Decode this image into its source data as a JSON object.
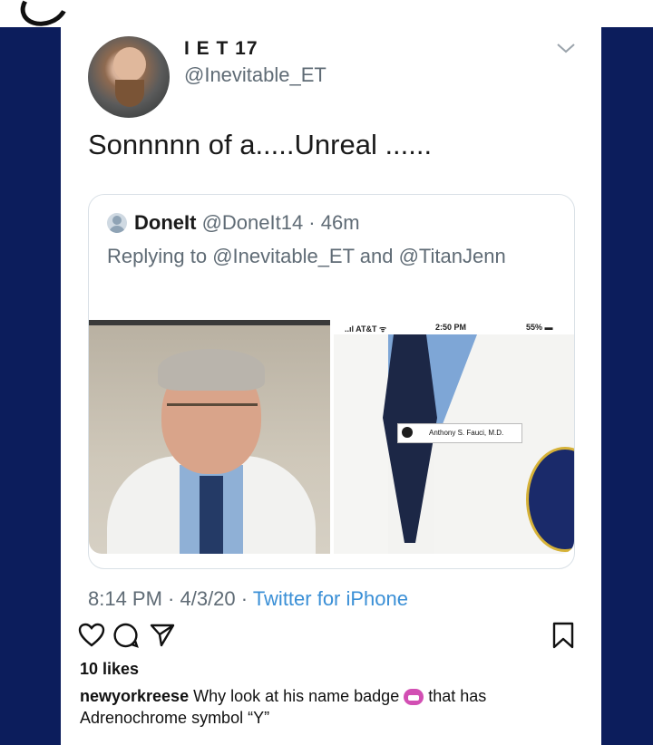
{
  "tweet": {
    "display_name": "I E T 17",
    "handle": "@Inevitable_ET",
    "text": "Sonnnnn of a.....Unreal ......",
    "timestamp": "8:14 PM · 4/3/20 · ",
    "source": "Twitter for iPhone"
  },
  "quoted": {
    "name": "DoneIt",
    "handle_time": " @DoneIt14 · 46m",
    "reply_prefix": "Replying to ",
    "reply_mention_1": "@Inevitable_ET",
    "reply_and": " and ",
    "reply_mention_2": "@TitanJenn",
    "status_carrier": "..ıl AT&T ᯤ",
    "status_time": "2:50 PM",
    "status_battery": "55% ▬",
    "badge_text": "Anthony S. Fauci, M.D."
  },
  "post": {
    "likes": "10 likes",
    "caption_user": "newyorkreese",
    "caption_part1": " Why look at his name badge ",
    "caption_part2": " that has Adrenochrome symbol “Y”"
  },
  "colors": {
    "band": "#0c1d5c",
    "link": "#3a8fd6",
    "muted": "#5f6b75"
  }
}
